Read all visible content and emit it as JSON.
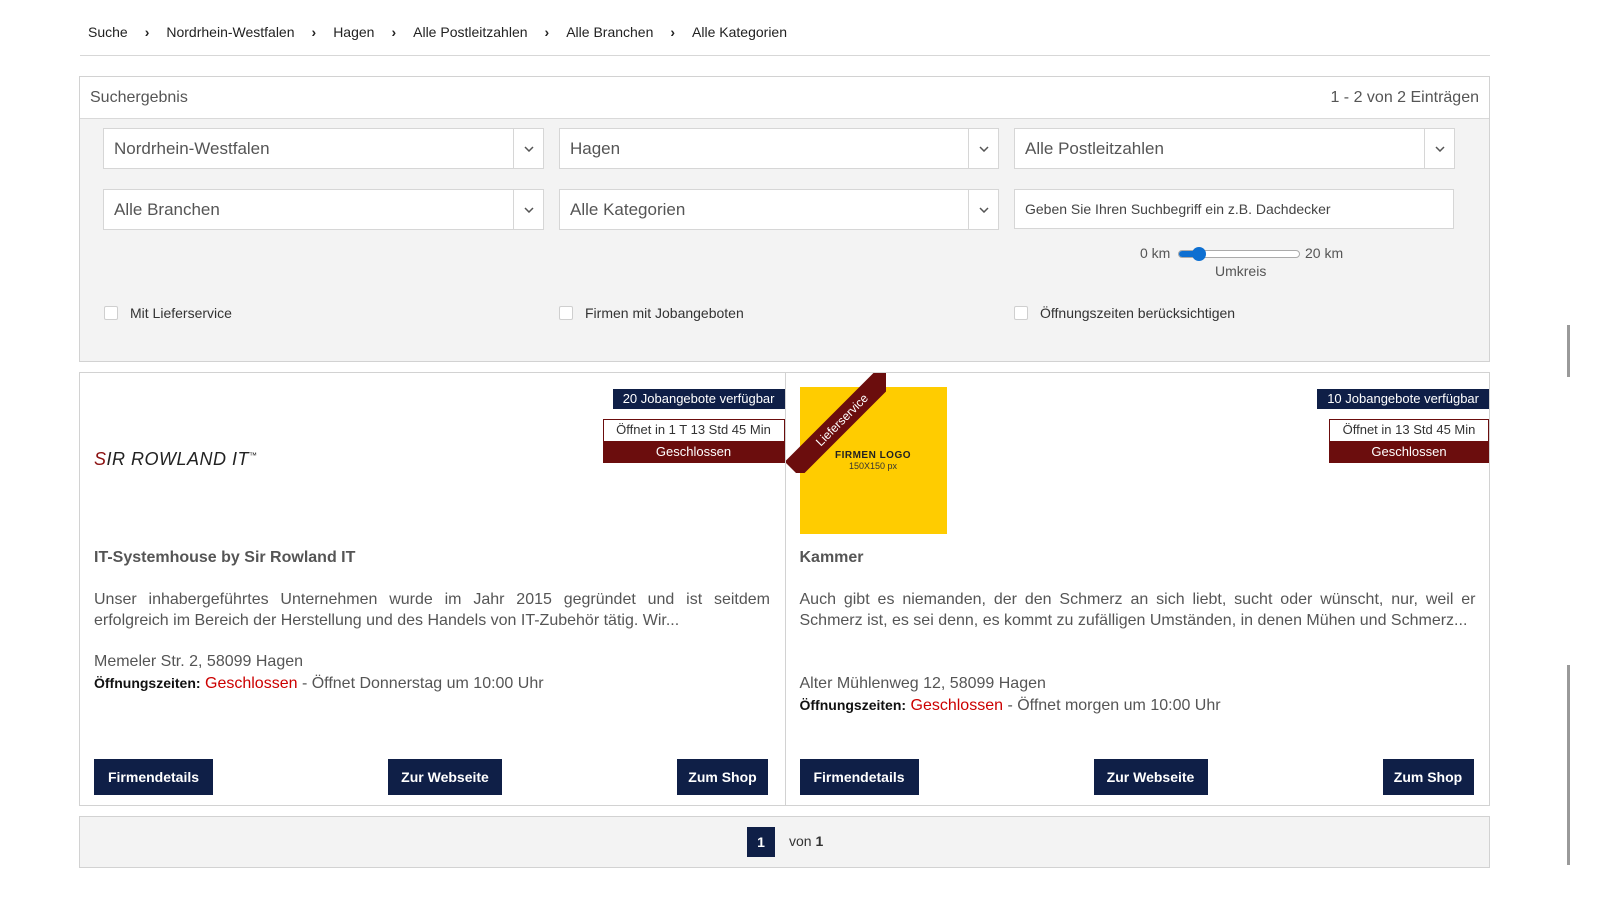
{
  "breadcrumb": [
    "Suche",
    "Nordrhein-Westfalen",
    "Hagen",
    "Alle Postleitzahlen",
    "Alle Branchen",
    "Alle Kategorien"
  ],
  "panel": {
    "title": "Suchergebnis",
    "count": "1 - 2 von 2 Einträgen",
    "selects": {
      "state": "Nordrhein-Westfalen",
      "city": "Hagen",
      "zip": "Alle Postleitzahlen",
      "branch": "Alle Branchen",
      "category": "Alle Kategorien"
    },
    "search_placeholder": "Geben Sie Ihren Suchbegriff ein z.B. Dachdecker",
    "radius": {
      "min_label": "0 km",
      "max_label": "20 km",
      "label": "Umkreis",
      "value_fraction": 0.12
    },
    "checkboxes": {
      "delivery": "Mit Lieferservice",
      "jobs": "Firmen mit Jobangeboten",
      "hours": "Öffnungszeiten berücksichtigen"
    }
  },
  "cards": [
    {
      "job_badge": "20 Jobangebote verfügbar",
      "opens_in": "Öffnet in 1 T 13 Std 45 Min",
      "status": "Geschlossen",
      "logo_text_first": "S",
      "logo_text_rest": "IR ROWLAND IT",
      "logo_tm": "™",
      "title": "IT-Systemhouse by Sir Rowland IT",
      "description": "Unser inhabergeführtes Unternehmen wurde im Jahr 2015 gegründet  und ist seitdem erfolgreich im Bereich der Herstellung und des Handels von IT-Zubehör tätig. Wir...",
      "address": "Memeler Str. 2, 58099 Hagen",
      "hours_label": "Öffnungszeiten:",
      "hours_status": "Geschlossen",
      "hours_next": " - Öffnet Donnerstag um 10:00 Uhr",
      "buttons": {
        "details": "Firmendetails",
        "website": "Zur Webseite",
        "shop": "Zum Shop"
      }
    },
    {
      "ribbon": "Lieferservice",
      "logo_title": "FIRMEN LOGO",
      "logo_size": "150X150 px",
      "job_badge": "10 Jobangebote verfügbar",
      "opens_in": "Öffnet in 13 Std 45 Min",
      "status": "Geschlossen",
      "title": "Kammer",
      "description": "Auch gibt es niemanden, der den Schmerz an sich liebt, sucht oder wünscht, nur, weil er Schmerz ist, es sei denn, es kommt zu zufälligen Umständen, in denen Mühen und Schmerz...",
      "address": "Alter Mühlenweg 12, 58099 Hagen",
      "hours_label": "Öffnungszeiten:",
      "hours_status": "Geschlossen",
      "hours_next": " - Öffnet morgen um 10:00 Uhr",
      "buttons": {
        "details": "Firmendetails",
        "website": "Zur Webseite",
        "shop": "Zum Shop"
      }
    }
  ],
  "pagination": {
    "current": "1",
    "of_label": "von",
    "total": "1"
  },
  "icons": {
    "breadcrumb_separator": "chevron-right-icon",
    "select_arrow": "chevron-down-icon"
  },
  "colors": {
    "navy": "#0f1f47",
    "maroon": "#6b0d0d",
    "closed_red": "#cc0000",
    "logo_yellow": "#ffcc00",
    "slider_blue": "#0d6fd1"
  }
}
